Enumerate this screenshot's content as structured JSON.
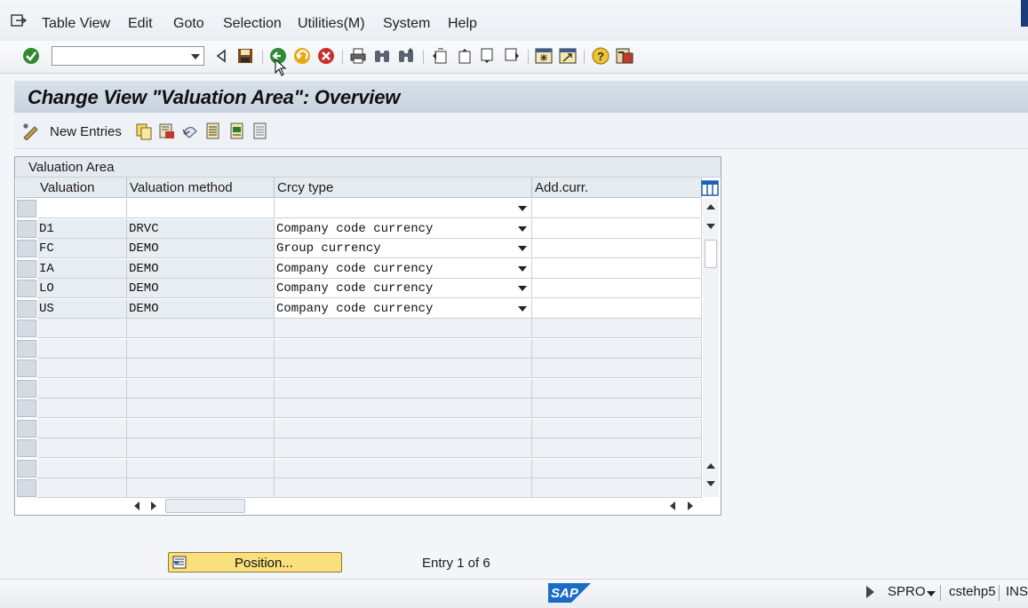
{
  "menubar": {
    "items": [
      {
        "label": "Table View"
      },
      {
        "label": "Edit"
      },
      {
        "label": "Goto"
      },
      {
        "label": "Selection"
      },
      {
        "label": "Utilities(M)"
      },
      {
        "label": "System"
      },
      {
        "label": "Help"
      }
    ]
  },
  "toolbar": {
    "command_field": {
      "value": "",
      "placeholder": ""
    }
  },
  "screen": {
    "title": "Change View \"Valuation Area\": Overview"
  },
  "app_toolbar": {
    "new_entries_label": "New Entries"
  },
  "table": {
    "title": "Valuation Area",
    "columns": [
      "Valuation",
      "Valuation method",
      "Crcy type",
      "Add.curr."
    ],
    "rows": [
      {
        "valuation": "",
        "method": "",
        "crcy_type": "",
        "add_curr": ""
      },
      {
        "valuation": "D1",
        "method": "DRVC",
        "crcy_type": "Company code currency",
        "add_curr": ""
      },
      {
        "valuation": "FC",
        "method": "DEMO",
        "crcy_type": "Group currency",
        "add_curr": ""
      },
      {
        "valuation": "IA",
        "method": "DEMO",
        "crcy_type": "Company code currency",
        "add_curr": ""
      },
      {
        "valuation": "LO",
        "method": "DEMO",
        "crcy_type": "Company code currency",
        "add_curr": ""
      },
      {
        "valuation": "US",
        "method": "DEMO",
        "crcy_type": "Company code currency",
        "add_curr": ""
      }
    ]
  },
  "footer": {
    "position_button_label": "Position...",
    "entry_info": "Entry 1 of 6"
  },
  "statusbar": {
    "logo_text": "SAP",
    "transaction": "SPRO",
    "server": "cstehp5",
    "mode": "INS"
  },
  "colors": {
    "title_bg": "#c8d3df",
    "position_button": "#f9e07d",
    "sap_blue": "#1a6bc7"
  }
}
